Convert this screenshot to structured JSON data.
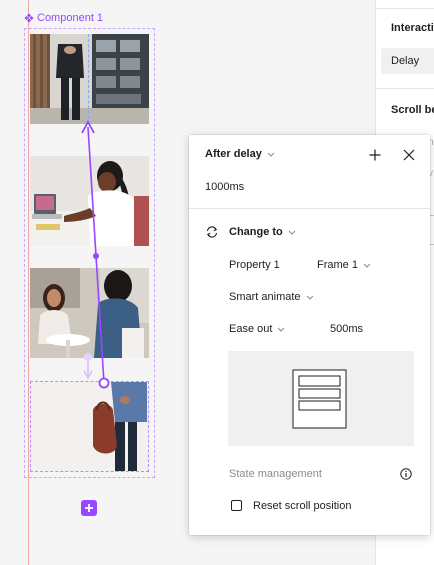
{
  "canvas": {
    "component_label": "Component 1"
  },
  "right_panel": {
    "section_interactions": "Interacti",
    "trigger_field": "Delay",
    "section_scroll": "Scroll be"
  },
  "popover": {
    "trigger": "After delay",
    "delay_value": "1000ms",
    "action": "Change to",
    "destination_variant_label": "Property 1",
    "destination_variant_value": "Frame 1",
    "animation": "Smart animate",
    "easing": "Ease out",
    "duration": "500ms",
    "state_management_label": "State management",
    "reset_scroll_label": "Reset scroll position",
    "reset_scroll_checked": false
  },
  "colors": {
    "accent_purple": "#9747ff",
    "guide_red": "#f0a6a6",
    "guide_blue": "#7aa7ff"
  },
  "icons": [
    "component-icon",
    "chevron-down-icon",
    "plus-icon",
    "close-icon",
    "swap-icon",
    "info-icon",
    "add-variant-icon"
  ]
}
